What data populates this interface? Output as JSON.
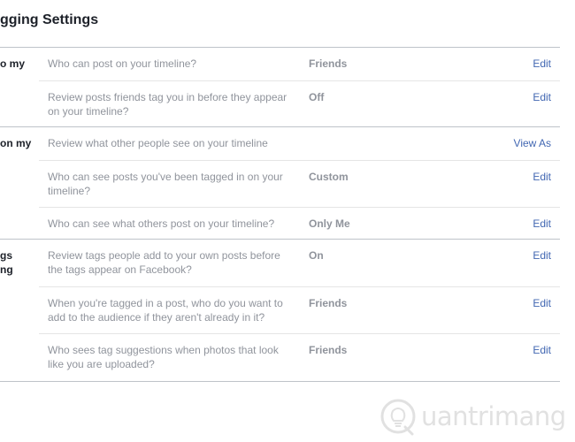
{
  "page": {
    "title": "gging Settings"
  },
  "sections": [
    {
      "label": "o my",
      "rows": [
        {
          "description": "Who can post on your timeline?",
          "value": "Friends",
          "action": "Edit"
        },
        {
          "description": "Review posts friends tag you in before they appear on your timeline?",
          "value": "Off",
          "action": "Edit"
        }
      ]
    },
    {
      "label": "on my",
      "rows": [
        {
          "description": "Review what other people see on your timeline",
          "value": "",
          "action": "View As"
        },
        {
          "description": "Who can see posts you've been tagged in on your timeline?",
          "value": "Custom",
          "action": "Edit"
        },
        {
          "description": "Who can see what others post on your timeline?",
          "value": "Only Me",
          "action": "Edit"
        }
      ]
    },
    {
      "label": "gs\nng",
      "rows": [
        {
          "description": "Review tags people add to your own posts before the tags appear on Facebook?",
          "value": "On",
          "action": "Edit"
        },
        {
          "description": "When you're tagged in a post, who do you want to add to the audience if they aren't already in it?",
          "value": "Friends",
          "action": "Edit"
        },
        {
          "description": "Who sees tag suggestions when photos that look like you are uploaded?",
          "value": "Friends",
          "action": "Edit"
        }
      ]
    }
  ],
  "watermark": {
    "text": "uantrimang",
    "icon": "lightbulb-q-logo"
  },
  "colors": {
    "text_dark": "#1d2129",
    "text_muted": "#90949c",
    "link": "#4267b2",
    "divider": "#bec3c9",
    "row_divider": "#e5e5e5"
  }
}
